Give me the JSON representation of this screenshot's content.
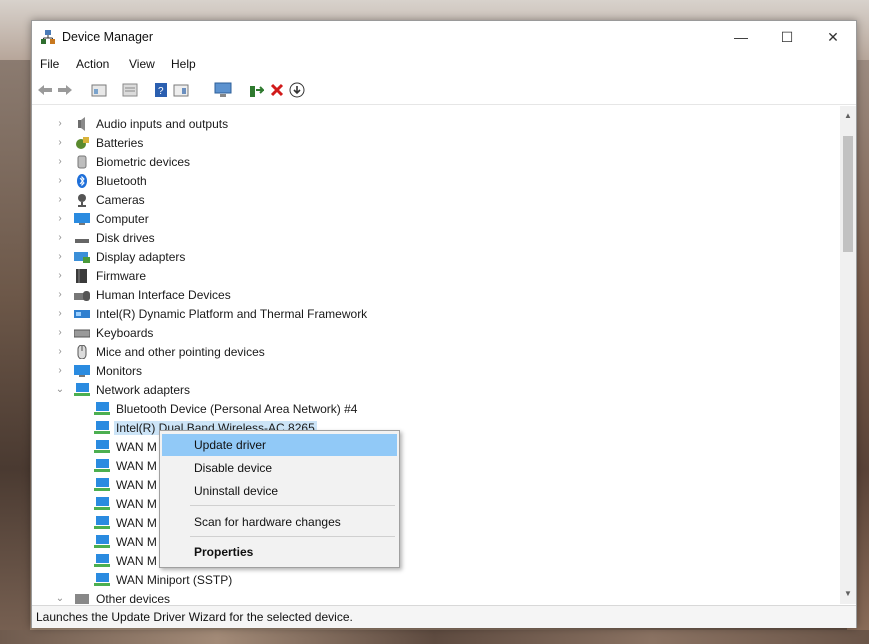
{
  "window": {
    "title": "Device Manager"
  },
  "controls": {
    "minimize": "—",
    "maximize": "☐",
    "close": "✕"
  },
  "menu": [
    "File",
    "Action",
    "View",
    "Help"
  ],
  "toolbar": [
    "back-icon",
    "forward-icon",
    "properties-icon",
    "show-hide-icon",
    "help-icon",
    "view-icon",
    "scan-icon",
    "update-driver-icon",
    "uninstall-icon",
    "download-icon"
  ],
  "tree": {
    "categories": [
      {
        "label": "Audio inputs and outputs",
        "icon": "speaker-icon"
      },
      {
        "label": "Batteries",
        "icon": "battery-icon"
      },
      {
        "label": "Biometric devices",
        "icon": "fingerprint-icon"
      },
      {
        "label": "Bluetooth",
        "icon": "bluetooth-icon"
      },
      {
        "label": "Cameras",
        "icon": "camera-icon"
      },
      {
        "label": "Computer",
        "icon": "computer-icon"
      },
      {
        "label": "Disk drives",
        "icon": "disk-icon"
      },
      {
        "label": "Display adapters",
        "icon": "display-icon"
      },
      {
        "label": "Firmware",
        "icon": "firmware-icon"
      },
      {
        "label": "Human Interface Devices",
        "icon": "hid-icon"
      },
      {
        "label": "Intel(R) Dynamic Platform and Thermal Framework",
        "icon": "chip-icon"
      },
      {
        "label": "Keyboards",
        "icon": "keyboard-icon"
      },
      {
        "label": "Mice and other pointing devices",
        "icon": "mouse-icon"
      },
      {
        "label": "Monitors",
        "icon": "monitor-icon"
      },
      {
        "label": "Network adapters",
        "icon": "network-icon"
      }
    ],
    "network_children": [
      "Bluetooth Device (Personal Area Network) #4",
      "Intel(R) Dual Band Wireless-AC 8265",
      "WAN M",
      "WAN M",
      "WAN M",
      "WAN M",
      "WAN M",
      "WAN M",
      "WAN M",
      "WAN Miniport (SSTP)"
    ],
    "last_category": "Other devices"
  },
  "context_menu": {
    "update": "Update driver",
    "disable": "Disable device",
    "uninstall": "Uninstall device",
    "scan": "Scan for hardware changes",
    "properties": "Properties"
  },
  "status": "Launches the Update Driver Wizard for the selected device.",
  "colors": {
    "selection": "#cce4f7",
    "menu_highlight": "#91c9f7"
  }
}
